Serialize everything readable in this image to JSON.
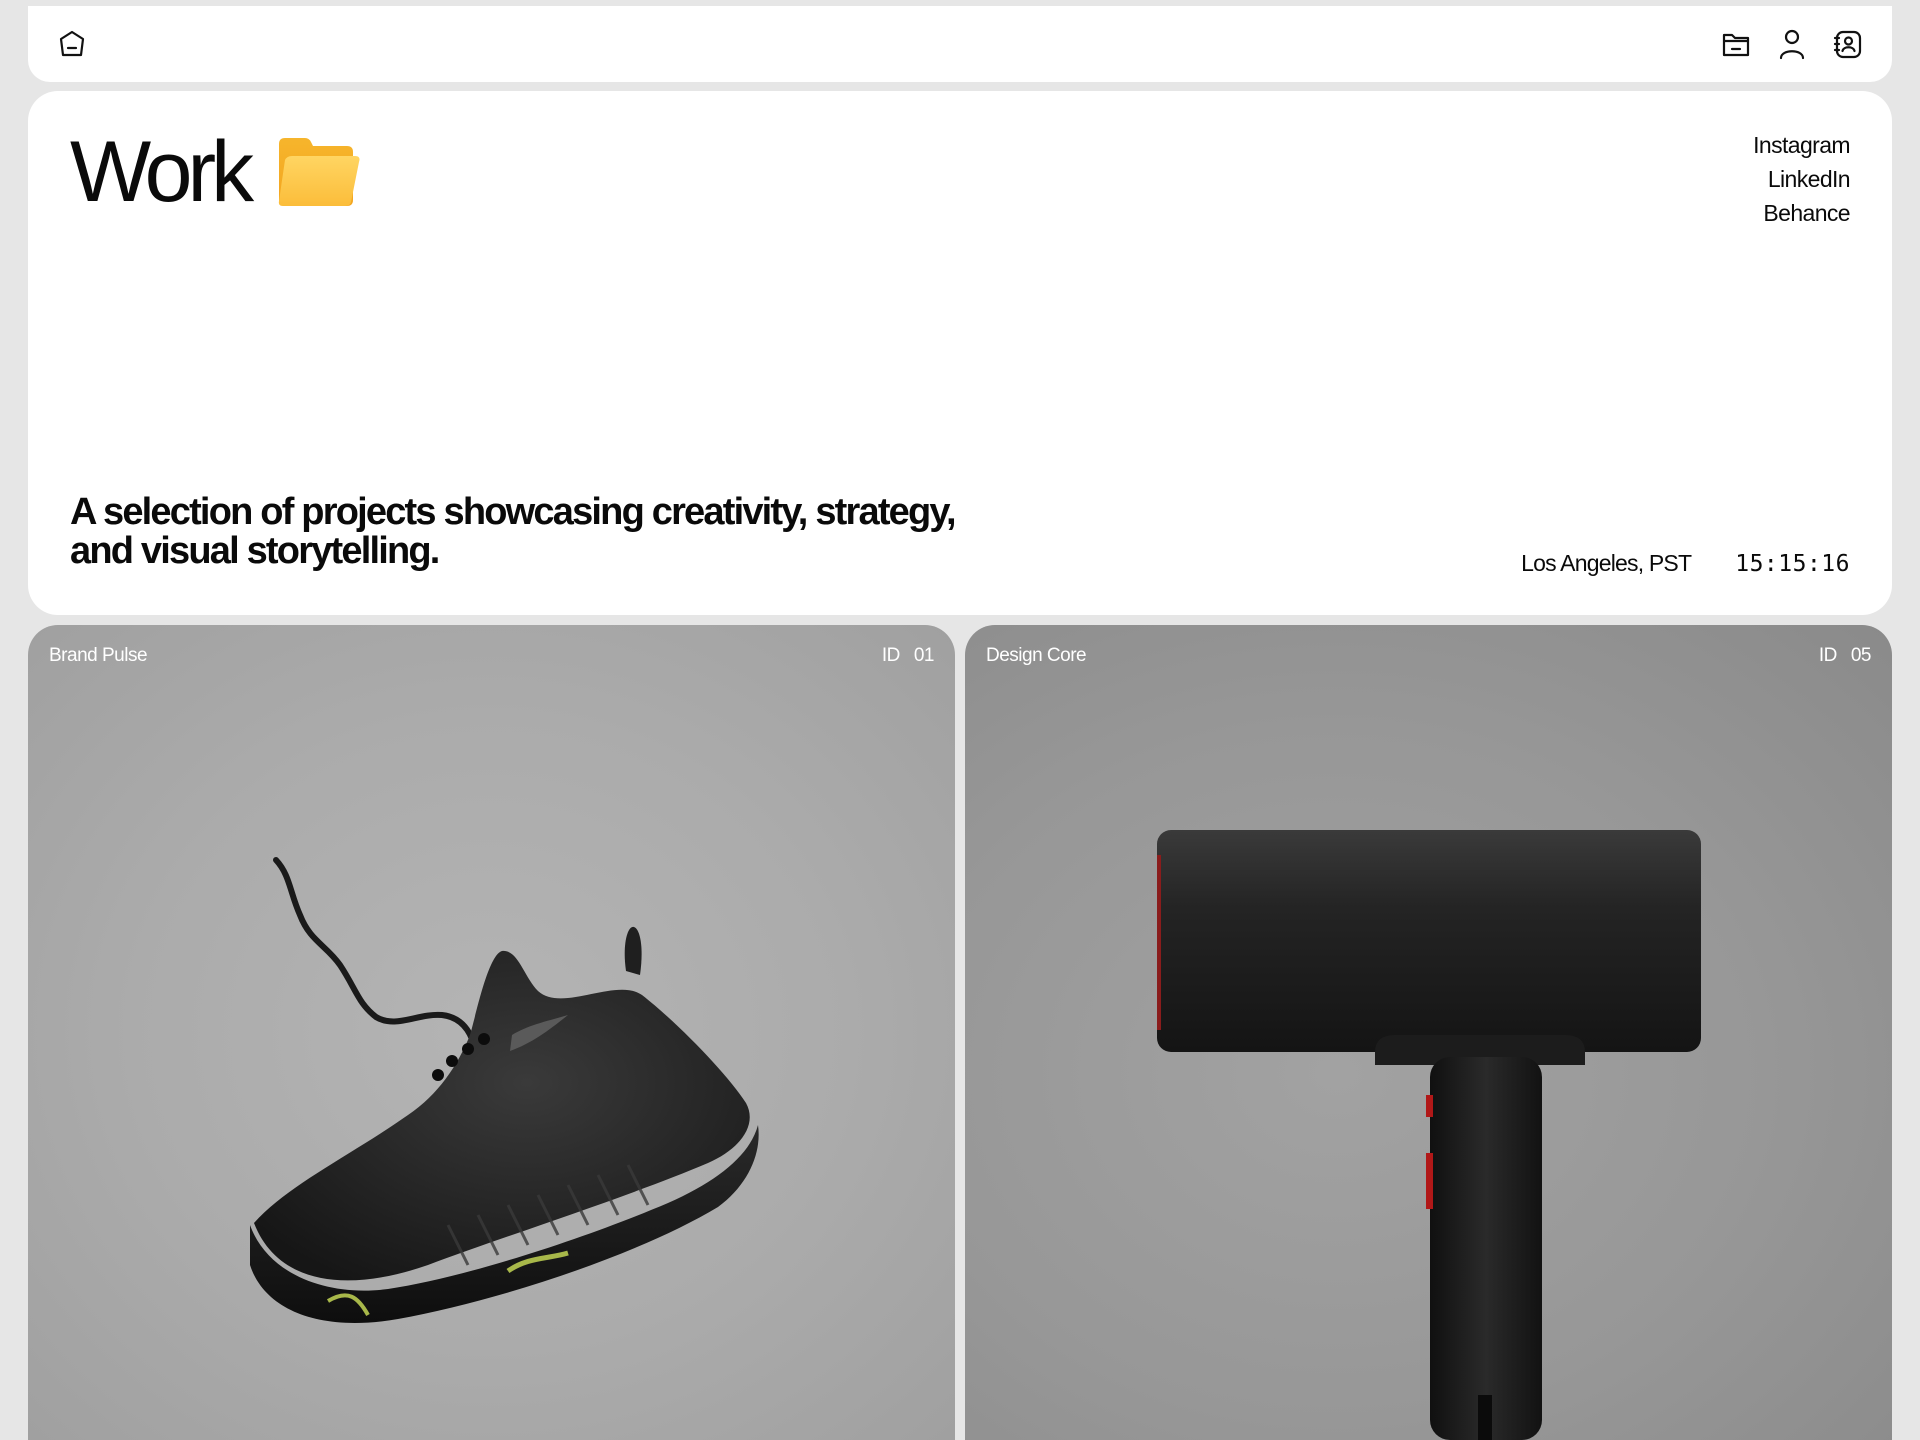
{
  "header": {
    "logo_icon": "home-pentagon-icon",
    "actions": [
      {
        "icon": "folder-icon"
      },
      {
        "icon": "user-icon"
      },
      {
        "icon": "contact-card-icon"
      }
    ]
  },
  "hero": {
    "title": "Work",
    "title_icon": "open-folder-emoji",
    "tagline": "A selection of projects showcasing creativity, strategy, and visual storytelling.",
    "social": [
      "Instagram",
      "LinkedIn",
      "Behance"
    ],
    "location": "Los Angeles, PST",
    "time": "15:15:16"
  },
  "projects": [
    {
      "name": "Brand Pulse",
      "id_label": "ID",
      "id": "01",
      "image": "black running sneaker"
    },
    {
      "name": "Design Core",
      "id_label": "ID",
      "id": "05",
      "image": "black hair dryer"
    }
  ],
  "colors": {
    "background": "#e6e6e6",
    "surface": "#ffffff",
    "text": "#0a0a0a",
    "folder": "#fbc13a"
  }
}
